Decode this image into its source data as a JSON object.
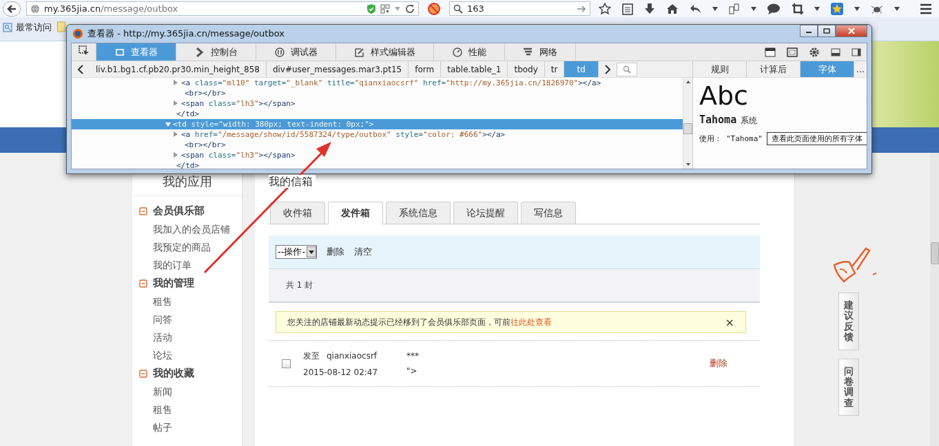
{
  "browser": {
    "url_host": "my.365jia.cn",
    "url_path": "/message/outbox",
    "search_value": "163",
    "bookmarks": [
      "最常访问"
    ]
  },
  "devtools": {
    "title": "查看器 - http://my.365jia.cn/message/outbox",
    "tabs": [
      {
        "label": "查看器",
        "selected": true
      },
      {
        "label": "控制台",
        "selected": false
      },
      {
        "label": "调试器",
        "selected": false
      },
      {
        "label": "样式编辑器",
        "selected": false
      },
      {
        "label": "性能",
        "selected": false
      },
      {
        "label": "网络",
        "selected": false
      }
    ],
    "breadcrumbs": [
      {
        "label": "liv.b1.bg1.cf.pb20.pr30.min_height_858",
        "selected": false
      },
      {
        "label": "div#user_messages.mar3.pt15",
        "selected": false
      },
      {
        "label": "form",
        "selected": false
      },
      {
        "label": "table.table_1",
        "selected": false
      },
      {
        "label": "tbody",
        "selected": false
      },
      {
        "label": "tr",
        "selected": false
      },
      {
        "label": "td",
        "selected": true
      }
    ],
    "markup": [
      {
        "children": [
          {
            "expanded": false,
            "parts": [
              {
                "kind": "tag",
                "text": "<a"
              },
              {
                "kind": "attr",
                "text": " class="
              },
              {
                "kind": "value",
                "text": "\"ml10\""
              },
              {
                "kind": "attr",
                "text": " target="
              },
              {
                "kind": "value",
                "text": "\"_blank\""
              },
              {
                "kind": "attr",
                "text": " title="
              },
              {
                "kind": "value",
                "text": "\"qianxiaocsrf\""
              },
              {
                "kind": "attr",
                "text": " href="
              },
              {
                "kind": "value",
                "text": "\"http://my.365jia.cn/1826970\""
              },
              {
                "kind": "tag",
                "text": "></a>"
              }
            ]
          },
          {
            "parts": [
              {
                "kind": "tag",
                "text": "<br></br>"
              }
            ]
          },
          {
            "expanded": false,
            "parts": [
              {
                "kind": "tag",
                "text": "<span"
              },
              {
                "kind": "attr",
                "text": " class="
              },
              {
                "kind": "value",
                "text": "\"lh3\""
              },
              {
                "kind": "tag",
                "text": "></span>"
              }
            ]
          }
        ],
        "closing": "</td>"
      },
      {
        "expanded": true,
        "selected": true,
        "parts": [
          {
            "kind": "tag",
            "text": "<td"
          },
          {
            "kind": "attr",
            "text": " style="
          },
          {
            "kind": "value",
            "text": "\"width: 380px; text-indent: 0px;\""
          },
          {
            "kind": "tag",
            "text": ">"
          }
        ],
        "children": [
          {
            "expanded": false,
            "parts": [
              {
                "kind": "tag",
                "text": "<a"
              },
              {
                "kind": "attr",
                "text": " href="
              },
              {
                "kind": "value",
                "text": "\"/message/show/id/5587324/type/outbox\""
              },
              {
                "kind": "attr",
                "text": " style="
              },
              {
                "kind": "value",
                "text": "\"color: #666\""
              },
              {
                "kind": "tag",
                "text": "></a>"
              }
            ]
          },
          {
            "parts": [
              {
                "kind": "tag",
                "text": "<br></br>"
              }
            ]
          },
          {
            "expanded": false,
            "parts": [
              {
                "kind": "tag",
                "text": "<span"
              },
              {
                "kind": "attr",
                "text": " class="
              },
              {
                "kind": "value",
                "text": "\"lh3\""
              },
              {
                "kind": "tag",
                "text": "></span>"
              }
            ]
          }
        ],
        "closing": "</td>"
      }
    ],
    "side_tabs": [
      {
        "label": "规则",
        "selected": false
      },
      {
        "label": "计算后",
        "selected": false
      },
      {
        "label": "字体",
        "selected": true
      },
      {
        "label": "...",
        "selected": false
      }
    ],
    "font_panel": {
      "preview": "Abc",
      "font_name": "Tahoma",
      "font_source": "系统",
      "usage_label": "使用：",
      "usage_value": "\"Tahoma\"",
      "all_fonts_button": "查看此页面使用的所有字体"
    }
  },
  "sidebar": {
    "title": "我的应用",
    "groups": [
      {
        "label": "会员俱乐部",
        "expanded": true,
        "children": [
          "我加入的会员店铺",
          "我预定的商品",
          "我的订单"
        ]
      },
      {
        "label": "我的管理",
        "expanded": true,
        "children": [
          "租售",
          "问答",
          "活动",
          "论坛"
        ]
      },
      {
        "label": "我的收藏",
        "expanded": true,
        "children": [
          "新闻",
          "租售",
          "帖子"
        ]
      }
    ]
  },
  "mailbox": {
    "title": "我的信箱",
    "tabs": [
      {
        "label": "收件箱",
        "selected": false
      },
      {
        "label": "发件箱",
        "selected": true
      },
      {
        "label": "系统信息",
        "selected": false
      },
      {
        "label": "论坛提醒",
        "selected": false
      },
      {
        "label": "写信息",
        "selected": false
      }
    ],
    "action_select": "--操作-",
    "actions": [
      "删除",
      "清空"
    ],
    "count": "共 1 封",
    "notice": {
      "text": "您关注的店铺最新动态提示已经移到了会员俱乐部页面，可前",
      "link": "往此处查看",
      "close": "×"
    },
    "messages": [
      {
        "checked": false,
        "direction": "发至",
        "recipient": "qianxiaocsrf",
        "time": "2015-08-12 02:47",
        "subject": "***",
        "preview": "\">",
        "delete": "删除"
      }
    ]
  },
  "side_buttons": [
    "建议反馈",
    "问卷调查"
  ]
}
